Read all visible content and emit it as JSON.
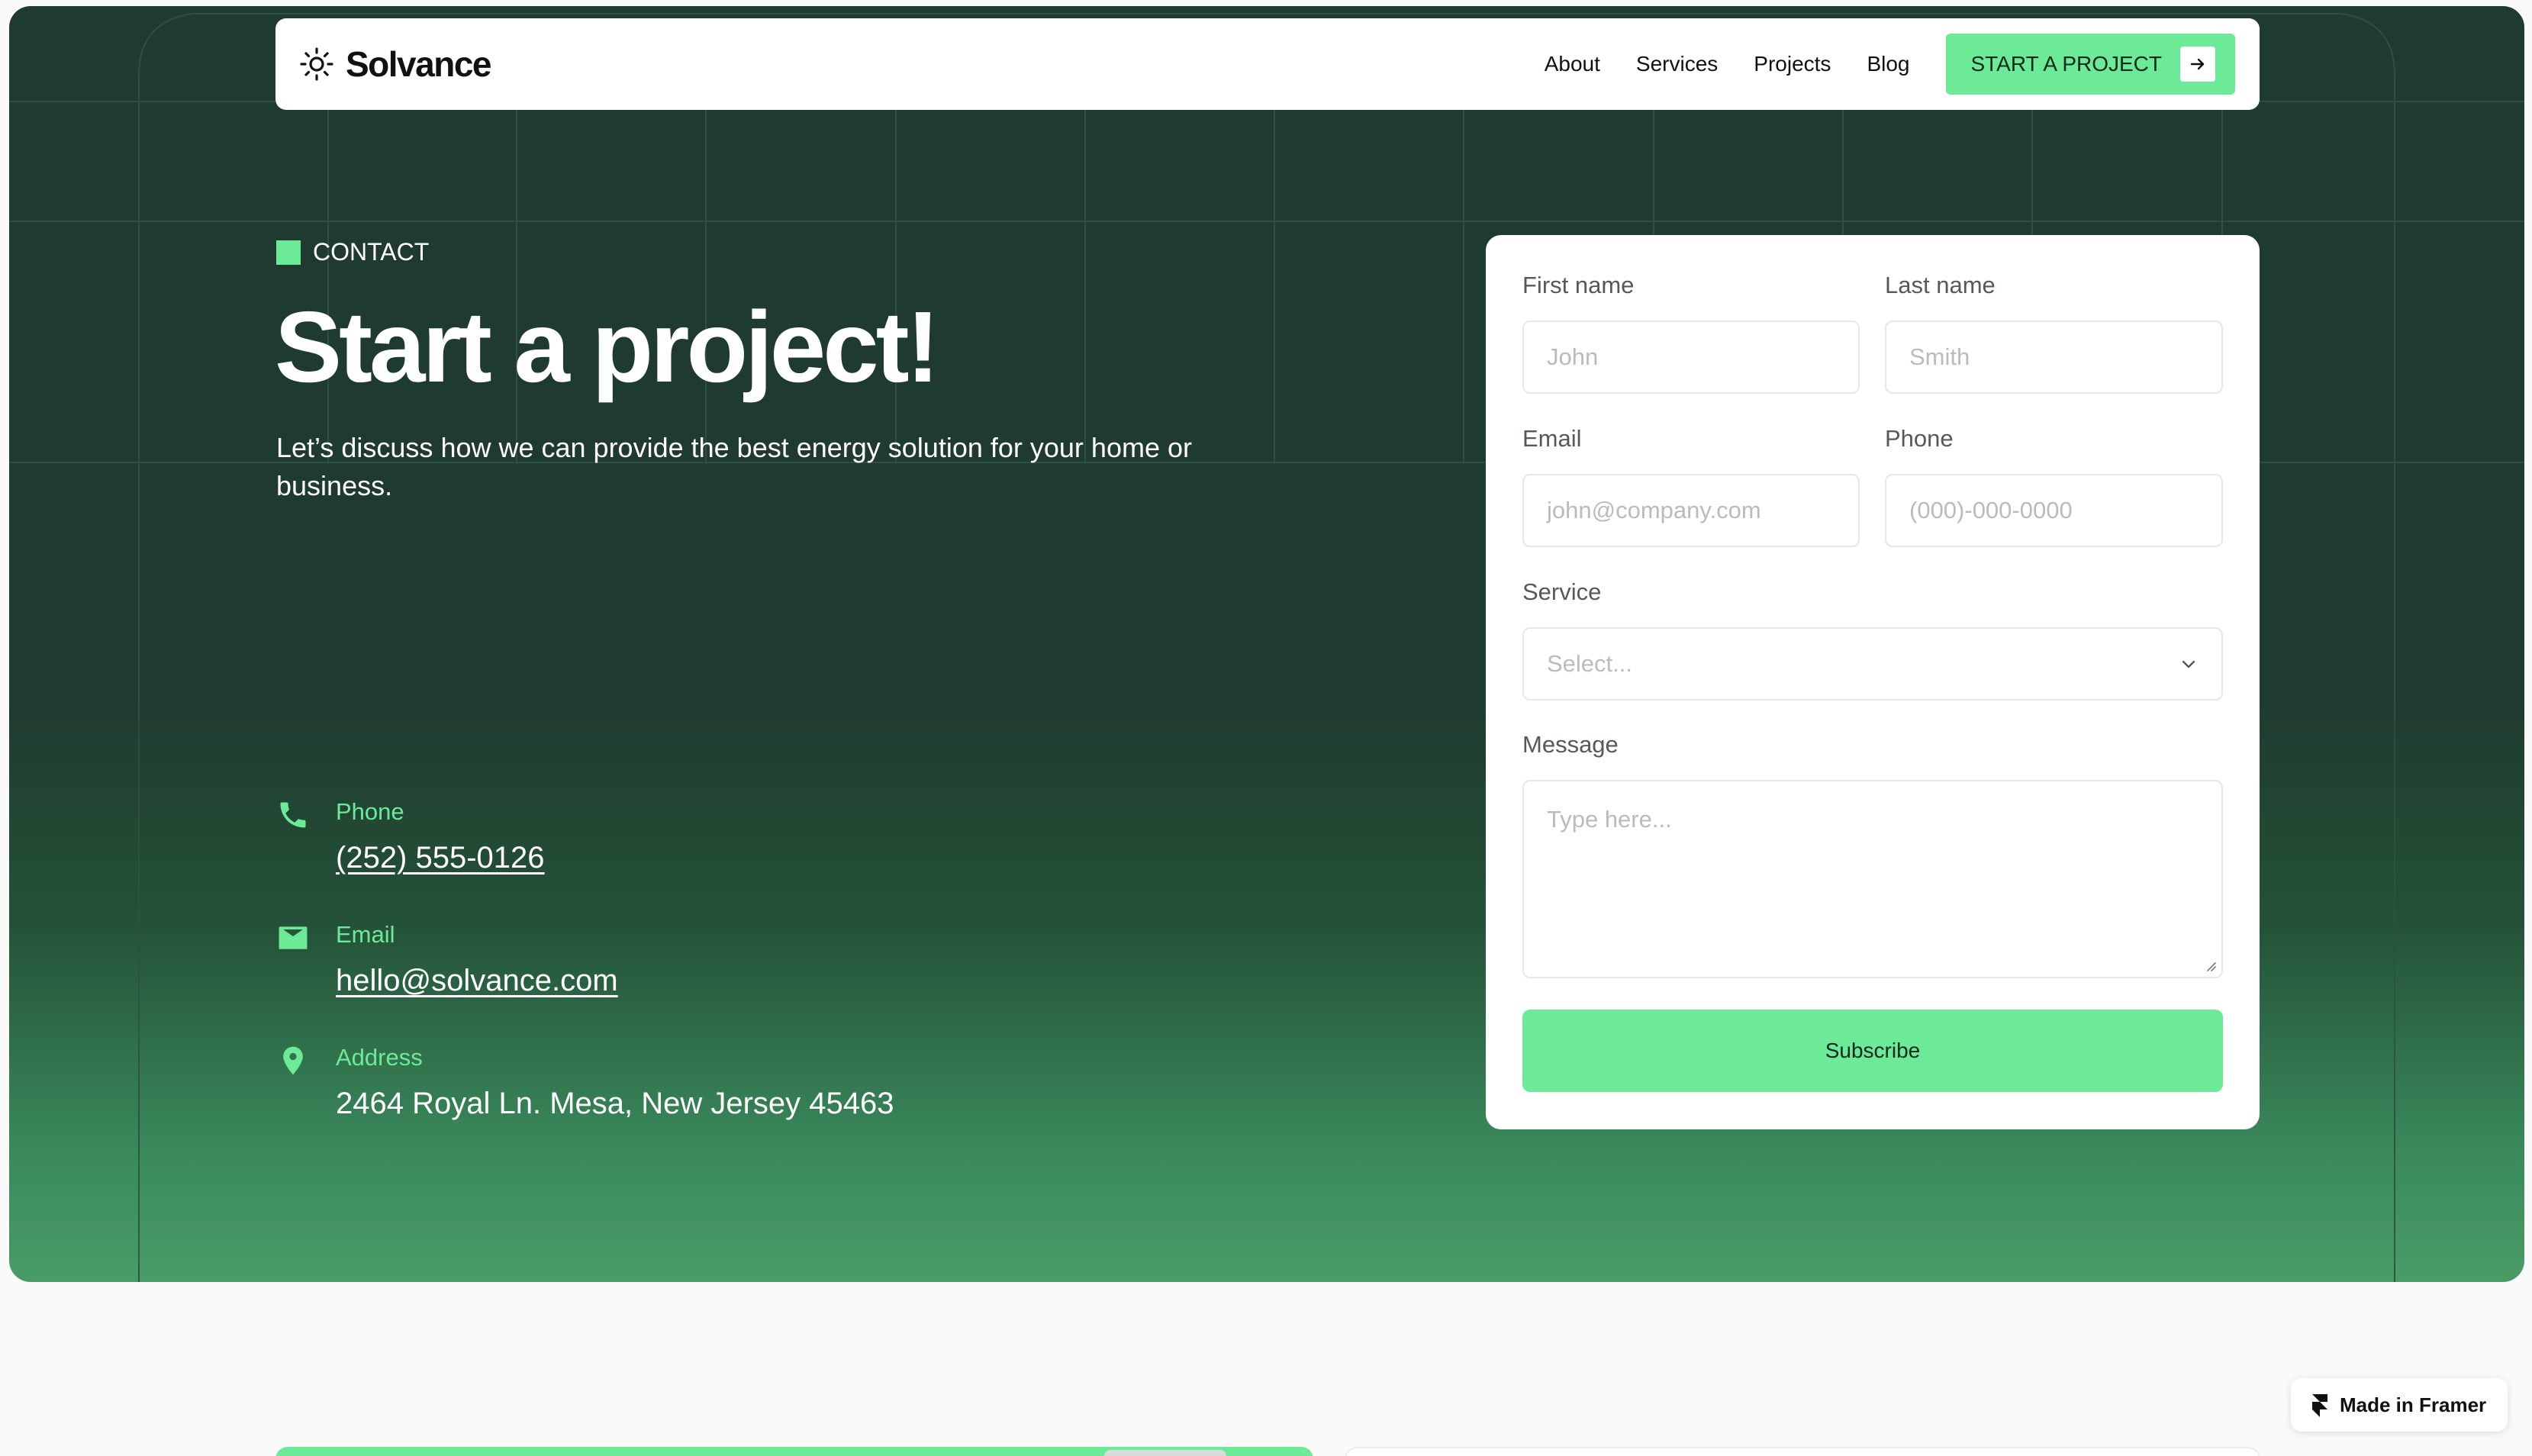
{
  "nav": {
    "brand": "Solvance",
    "links": [
      "About",
      "Services",
      "Projects",
      "Blog"
    ],
    "cta": "START A PROJECT"
  },
  "hero": {
    "eyebrow": "CONTACT",
    "title": "Start a project!",
    "subtitle": "Let’s discuss how we can provide the best energy solution for your home or business."
  },
  "contact": {
    "phone": {
      "label": "Phone",
      "value": "(252) 555-0126",
      "icon": "phone-icon"
    },
    "email": {
      "label": "Email",
      "value": "hello@solvance.com",
      "icon": "mail-icon"
    },
    "address": {
      "label": "Address",
      "value": "2464 Royal Ln. Mesa, New Jersey 45463",
      "icon": "location-pin-icon"
    }
  },
  "form": {
    "first_name": {
      "label": "First name",
      "placeholder": "John"
    },
    "last_name": {
      "label": "Last name",
      "placeholder": "Smith"
    },
    "email": {
      "label": "Email",
      "placeholder": "john@company.com"
    },
    "phone": {
      "label": "Phone",
      "placeholder": "(000)-000-0000"
    },
    "service": {
      "label": "Service",
      "placeholder": "Select..."
    },
    "message": {
      "label": "Message",
      "placeholder": "Type here..."
    },
    "submit": "Subscribe"
  },
  "badge": {
    "label": "Made in Framer"
  },
  "colors": {
    "accent": "#6cea98",
    "hero_dark": "#1f3a2f",
    "hero_light": "#4a9c67",
    "page_bg": "#fafafa"
  }
}
